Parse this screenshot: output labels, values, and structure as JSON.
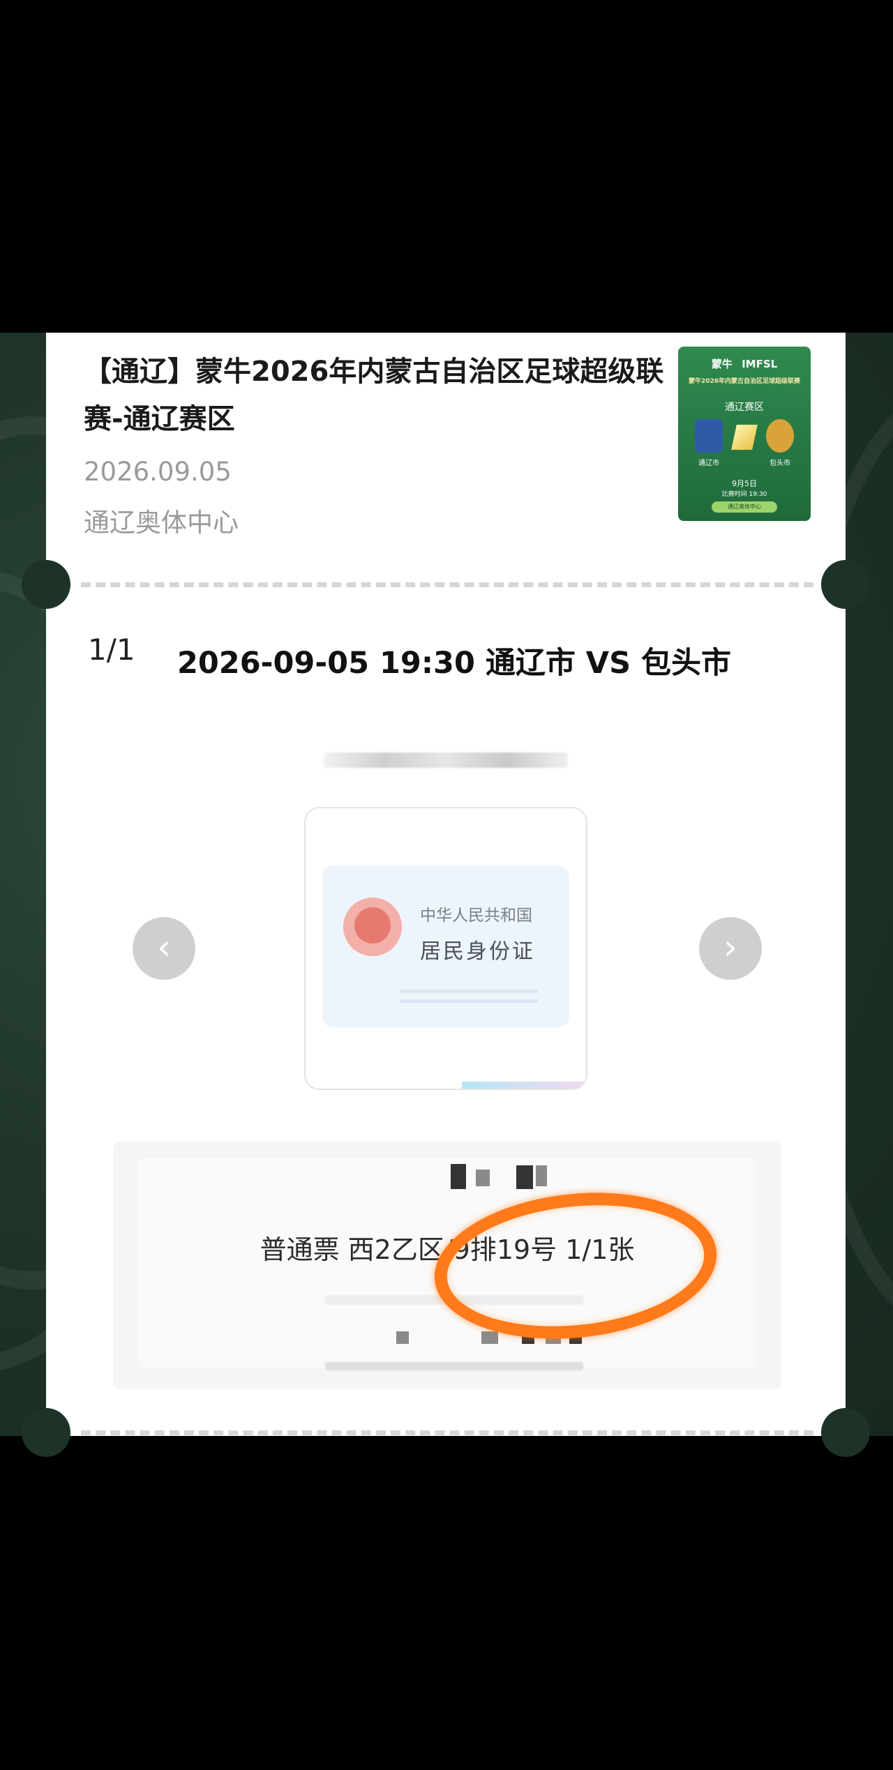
{
  "event": {
    "title": "【通辽】蒙牛2026年内蒙古自治区足球超级联赛-通辽赛区",
    "date": "2026.09.05",
    "venue": "通辽奥体中心"
  },
  "poster": {
    "brand": "蒙牛",
    "league": "IMFSL",
    "headline": "蒙牛2026年内蒙古自治区足球超级联赛",
    "region": "通辽赛区",
    "home_team": "通辽市",
    "away_team": "包头市",
    "match_day": "9月5日",
    "kickoff": "比赛时间 19:30",
    "footer": "通辽奥体中心"
  },
  "ticket": {
    "page_count": "1/1",
    "match_title": "2026-09-05 19:30 通辽市 VS 包头市"
  },
  "id_card": {
    "line1": "中华人民共和国",
    "line2": "居民身份证"
  },
  "navigation": {
    "prev_icon": "chevron-left-icon",
    "next_icon": "chevron-right-icon",
    "prev_glyph": "‹",
    "next_glyph": "›"
  },
  "seat": {
    "description": "普通票 西2乙区/9排19号 1/1张"
  },
  "colors": {
    "ticket_bg": "#ffffff",
    "frame_green": "#1f3529",
    "highlight": "#ff7a1a"
  }
}
